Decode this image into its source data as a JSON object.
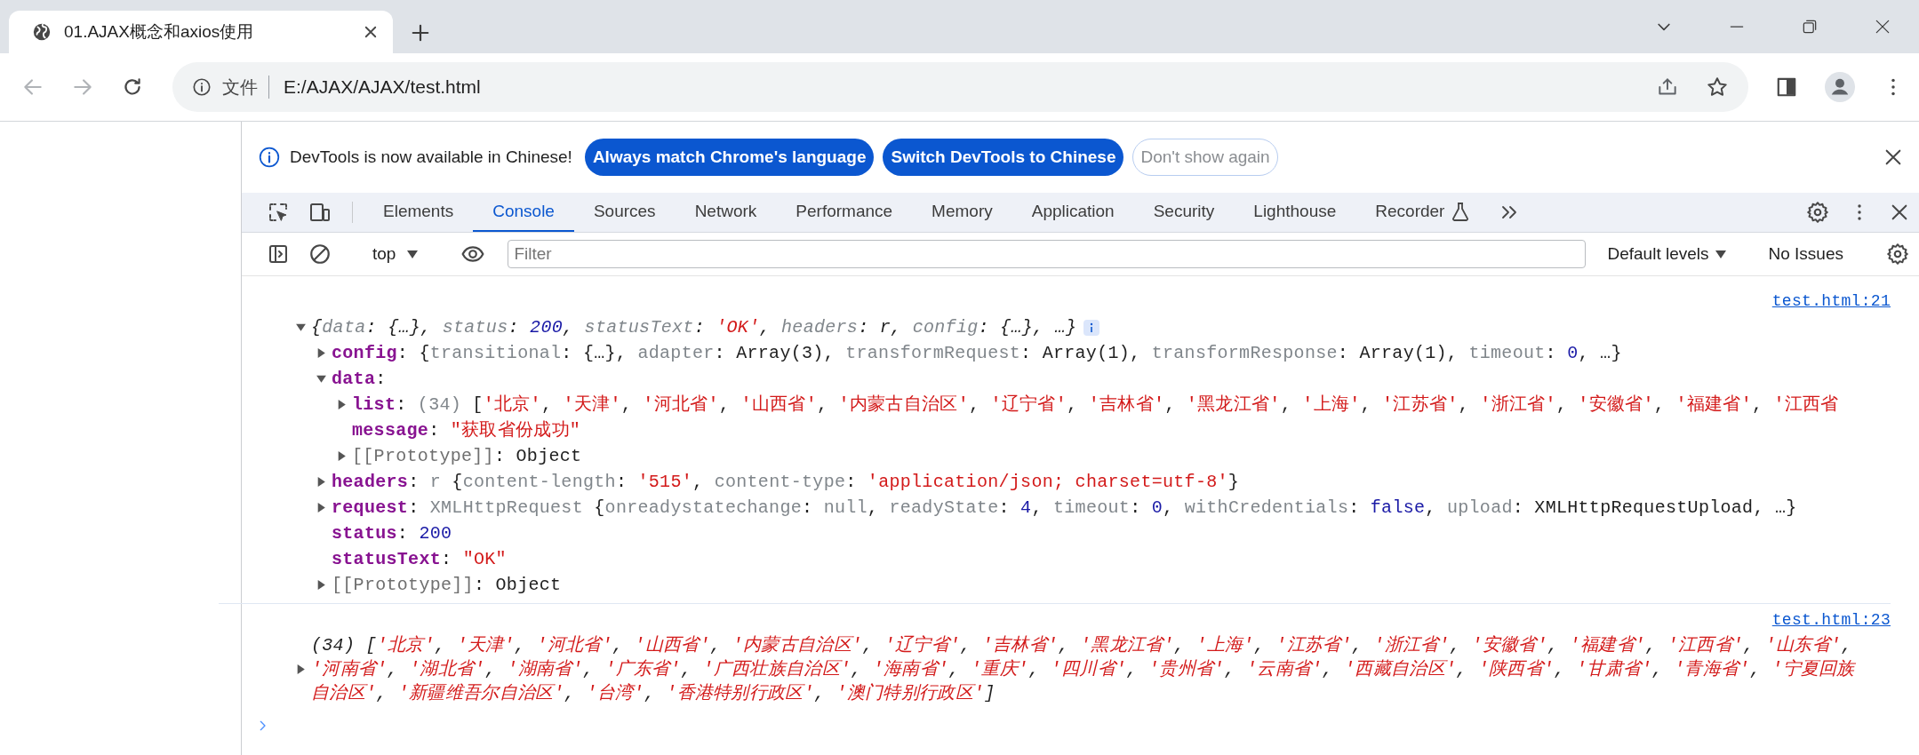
{
  "browser": {
    "tab": {
      "title": "01.AJAX概念和axios使用"
    },
    "security_label": "文件",
    "url": "E:/AJAX/AJAX/test.html"
  },
  "devtools": {
    "infobar": {
      "message": "DevTools is now available in Chinese!",
      "buttons": [
        {
          "kind": "primary",
          "label": "Always match Chrome's language"
        },
        {
          "kind": "primary",
          "label": "Switch DevTools to Chinese"
        },
        {
          "kind": "outline",
          "label": "Don't show again"
        }
      ]
    },
    "tabs": [
      {
        "label": "Elements",
        "selected": false,
        "experimental": false
      },
      {
        "label": "Console",
        "selected": true,
        "experimental": false
      },
      {
        "label": "Sources",
        "selected": false,
        "experimental": false
      },
      {
        "label": "Network",
        "selected": false,
        "experimental": false
      },
      {
        "label": "Performance",
        "selected": false,
        "experimental": false
      },
      {
        "label": "Memory",
        "selected": false,
        "experimental": false
      },
      {
        "label": "Application",
        "selected": false,
        "experimental": false
      },
      {
        "label": "Security",
        "selected": false,
        "experimental": false
      },
      {
        "label": "Lighthouse",
        "selected": false,
        "experimental": false
      },
      {
        "label": "Recorder",
        "selected": false,
        "experimental": true
      }
    ],
    "console_toolbar": {
      "context": "top",
      "filter_placeholder": "Filter",
      "levels": "Default levels",
      "issues": "No Issues"
    },
    "console": {
      "messages": [
        {
          "kind": "object",
          "source": "test.html:21",
          "expanded": true,
          "summary": [
            {
              "kind": "punct",
              "text": "{"
            },
            {
              "kind": "dimkey",
              "text": "data"
            },
            {
              "kind": "punct",
              "text": ": {…}, "
            },
            {
              "kind": "dimkey",
              "text": "status"
            },
            {
              "kind": "punct",
              "text": ": "
            },
            {
              "kind": "number",
              "text": "200"
            },
            {
              "kind": "punct",
              "text": ", "
            },
            {
              "kind": "dimkey",
              "text": "statusText"
            },
            {
              "kind": "punct",
              "text": ": "
            },
            {
              "kind": "string",
              "text": "'OK'"
            },
            {
              "kind": "punct",
              "text": ", "
            },
            {
              "kind": "dimkey",
              "text": "headers"
            },
            {
              "kind": "punct",
              "text": ": r, "
            },
            {
              "kind": "dimkey",
              "text": "config"
            },
            {
              "kind": "punct",
              "text": ": {…}, …}"
            }
          ],
          "children": [
            {
              "kind": "node",
              "expanded": false,
              "tokens": [
                {
                  "kind": "key",
                  "text": "config"
                },
                {
                  "kind": "punct",
                  "text": ": {"
                },
                {
                  "kind": "dimkey",
                  "text": "transitional"
                },
                {
                  "kind": "punct",
                  "text": ": {…}, "
                },
                {
                  "kind": "dimkey",
                  "text": "adapter"
                },
                {
                  "kind": "punct",
                  "text": ": Array(3), "
                },
                {
                  "kind": "dimkey",
                  "text": "transformRequest"
                },
                {
                  "kind": "punct",
                  "text": ": Array(1), "
                },
                {
                  "kind": "dimkey",
                  "text": "transformResponse"
                },
                {
                  "kind": "punct",
                  "text": ": Array(1), "
                },
                {
                  "kind": "dimkey",
                  "text": "timeout"
                },
                {
                  "kind": "punct",
                  "text": ": "
                },
                {
                  "kind": "number",
                  "text": "0"
                },
                {
                  "kind": "punct",
                  "text": ", …}"
                }
              ]
            },
            {
              "kind": "node",
              "expanded": true,
              "tokens": [
                {
                  "kind": "key",
                  "text": "data"
                },
                {
                  "kind": "punct",
                  "text": ":"
                }
              ],
              "children": [
                {
                  "kind": "node",
                  "expanded": false,
                  "tokens": [
                    {
                      "kind": "key",
                      "text": "list"
                    },
                    {
                      "kind": "punct",
                      "text": ": "
                    },
                    {
                      "kind": "dimkey",
                      "text": "(34)"
                    },
                    {
                      "kind": "punct",
                      "text": " ["
                    },
                    {
                      "kind": "string",
                      "text": "'北京'"
                    },
                    {
                      "kind": "punct",
                      "text": ", "
                    },
                    {
                      "kind": "string",
                      "text": "'天津'"
                    },
                    {
                      "kind": "punct",
                      "text": ", "
                    },
                    {
                      "kind": "string",
                      "text": "'河北省'"
                    },
                    {
                      "kind": "punct",
                      "text": ", "
                    },
                    {
                      "kind": "string",
                      "text": "'山西省'"
                    },
                    {
                      "kind": "punct",
                      "text": ", "
                    },
                    {
                      "kind": "string",
                      "text": "'内蒙古自治区'"
                    },
                    {
                      "kind": "punct",
                      "text": ", "
                    },
                    {
                      "kind": "string",
                      "text": "'辽宁省'"
                    },
                    {
                      "kind": "punct",
                      "text": ", "
                    },
                    {
                      "kind": "string",
                      "text": "'吉林省'"
                    },
                    {
                      "kind": "punct",
                      "text": ", "
                    },
                    {
                      "kind": "string",
                      "text": "'黑龙江省'"
                    },
                    {
                      "kind": "punct",
                      "text": ", "
                    },
                    {
                      "kind": "string",
                      "text": "'上海'"
                    },
                    {
                      "kind": "punct",
                      "text": ", "
                    },
                    {
                      "kind": "string",
                      "text": "'江苏省'"
                    },
                    {
                      "kind": "punct",
                      "text": ", "
                    },
                    {
                      "kind": "string",
                      "text": "'浙江省'"
                    },
                    {
                      "kind": "punct",
                      "text": ", "
                    },
                    {
                      "kind": "string",
                      "text": "'安徽省'"
                    },
                    {
                      "kind": "punct",
                      "text": ", "
                    },
                    {
                      "kind": "string",
                      "text": "'福建省'"
                    },
                    {
                      "kind": "punct",
                      "text": ", "
                    },
                    {
                      "kind": "string",
                      "text": "'江西省"
                    }
                  ]
                },
                {
                  "kind": "leaf",
                  "tokens": [
                    {
                      "kind": "key",
                      "text": "message"
                    },
                    {
                      "kind": "punct",
                      "text": ": "
                    },
                    {
                      "kind": "string",
                      "text": "\"获取省份成功\""
                    }
                  ]
                },
                {
                  "kind": "node",
                  "expanded": false,
                  "tokens": [
                    {
                      "kind": "internal",
                      "text": "[[Prototype]]"
                    },
                    {
                      "kind": "punct",
                      "text": ": Object"
                    }
                  ]
                }
              ]
            },
            {
              "kind": "node",
              "expanded": false,
              "tokens": [
                {
                  "kind": "key",
                  "text": "headers"
                },
                {
                  "kind": "punct",
                  "text": ": "
                },
                {
                  "kind": "dimkey",
                  "text": "r"
                },
                {
                  "kind": "punct",
                  "text": " {"
                },
                {
                  "kind": "dimkey",
                  "text": "content-length"
                },
                {
                  "kind": "punct",
                  "text": ": "
                },
                {
                  "kind": "string",
                  "text": "'515'"
                },
                {
                  "kind": "punct",
                  "text": ", "
                },
                {
                  "kind": "dimkey",
                  "text": "content-type"
                },
                {
                  "kind": "punct",
                  "text": ": "
                },
                {
                  "kind": "string",
                  "text": "'application/json; charset=utf-8'"
                },
                {
                  "kind": "punct",
                  "text": "}"
                }
              ]
            },
            {
              "kind": "node",
              "expanded": false,
              "tokens": [
                {
                  "kind": "key",
                  "text": "request"
                },
                {
                  "kind": "punct",
                  "text": ": "
                },
                {
                  "kind": "dimkey",
                  "text": "XMLHttpRequest"
                },
                {
                  "kind": "punct",
                  "text": " {"
                },
                {
                  "kind": "dimkey",
                  "text": "onreadystatechange"
                },
                {
                  "kind": "punct",
                  "text": ": "
                },
                {
                  "kind": "dimkey",
                  "text": "null"
                },
                {
                  "kind": "punct",
                  "text": ", "
                },
                {
                  "kind": "dimkey",
                  "text": "readyState"
                },
                {
                  "kind": "punct",
                  "text": ": "
                },
                {
                  "kind": "number",
                  "text": "4"
                },
                {
                  "kind": "punct",
                  "text": ", "
                },
                {
                  "kind": "dimkey",
                  "text": "timeout"
                },
                {
                  "kind": "punct",
                  "text": ": "
                },
                {
                  "kind": "number",
                  "text": "0"
                },
                {
                  "kind": "punct",
                  "text": ", "
                },
                {
                  "kind": "dimkey",
                  "text": "withCredentials"
                },
                {
                  "kind": "punct",
                  "text": ": "
                },
                {
                  "kind": "number",
                  "text": "false"
                },
                {
                  "kind": "punct",
                  "text": ", "
                },
                {
                  "kind": "dimkey",
                  "text": "upload"
                },
                {
                  "kind": "punct",
                  "text": ": XMLHttpRequestUpload, …}"
                }
              ]
            },
            {
              "kind": "leaf",
              "tokens": [
                {
                  "kind": "key",
                  "text": "status"
                },
                {
                  "kind": "punct",
                  "text": ": "
                },
                {
                  "kind": "number",
                  "text": "200"
                }
              ]
            },
            {
              "kind": "leaf",
              "tokens": [
                {
                  "kind": "key",
                  "text": "statusText"
                },
                {
                  "kind": "punct",
                  "text": ": "
                },
                {
                  "kind": "string",
                  "text": "\"OK\""
                }
              ]
            },
            {
              "kind": "node",
              "expanded": false,
              "tokens": [
                {
                  "kind": "internal",
                  "text": "[[Prototype]]"
                },
                {
                  "kind": "punct",
                  "text": ": Object"
                }
              ]
            }
          ]
        },
        {
          "kind": "array",
          "source": "test.html:23",
          "expanded": false,
          "summary": [
            {
              "kind": "punct",
              "text": "(34) ["
            },
            {
              "kind": "string",
              "text": "'北京'"
            },
            {
              "kind": "punct",
              "text": ", "
            },
            {
              "kind": "string",
              "text": "'天津'"
            },
            {
              "kind": "punct",
              "text": ", "
            },
            {
              "kind": "string",
              "text": "'河北省'"
            },
            {
              "kind": "punct",
              "text": ", "
            },
            {
              "kind": "string",
              "text": "'山西省'"
            },
            {
              "kind": "punct",
              "text": ", "
            },
            {
              "kind": "string",
              "text": "'内蒙古自治区'"
            },
            {
              "kind": "punct",
              "text": ", "
            },
            {
              "kind": "string",
              "text": "'辽宁省'"
            },
            {
              "kind": "punct",
              "text": ", "
            },
            {
              "kind": "string",
              "text": "'吉林省'"
            },
            {
              "kind": "punct",
              "text": ", "
            },
            {
              "kind": "string",
              "text": "'黑龙江省'"
            },
            {
              "kind": "punct",
              "text": ", "
            },
            {
              "kind": "string",
              "text": "'上海'"
            },
            {
              "kind": "punct",
              "text": ", "
            },
            {
              "kind": "string",
              "text": "'江苏省'"
            },
            {
              "kind": "punct",
              "text": ", "
            },
            {
              "kind": "string",
              "text": "'浙江省'"
            },
            {
              "kind": "punct",
              "text": ", "
            },
            {
              "kind": "string",
              "text": "'安徽省'"
            },
            {
              "kind": "punct",
              "text": ", "
            },
            {
              "kind": "string",
              "text": "'福建省'"
            },
            {
              "kind": "punct",
              "text": ", "
            },
            {
              "kind": "string",
              "text": "'江西省'"
            },
            {
              "kind": "punct",
              "text": ", "
            },
            {
              "kind": "string",
              "text": "'山东省'"
            },
            {
              "kind": "punct",
              "text": ", "
            },
            {
              "kind": "string",
              "text": "'河南省'"
            },
            {
              "kind": "punct",
              "text": ", "
            },
            {
              "kind": "string",
              "text": "'湖北省'"
            },
            {
              "kind": "punct",
              "text": ", "
            },
            {
              "kind": "string",
              "text": "'湖南省'"
            },
            {
              "kind": "punct",
              "text": ", "
            },
            {
              "kind": "string",
              "text": "'广东省'"
            },
            {
              "kind": "punct",
              "text": ", "
            },
            {
              "kind": "string",
              "text": "'广西壮族自治区'"
            },
            {
              "kind": "punct",
              "text": ", "
            },
            {
              "kind": "string",
              "text": "'海南省'"
            },
            {
              "kind": "punct",
              "text": ", "
            },
            {
              "kind": "string",
              "text": "'重庆'"
            },
            {
              "kind": "punct",
              "text": ", "
            },
            {
              "kind": "string",
              "text": "'四川省'"
            },
            {
              "kind": "punct",
              "text": ", "
            },
            {
              "kind": "string",
              "text": "'贵州省'"
            },
            {
              "kind": "punct",
              "text": ", "
            },
            {
              "kind": "string",
              "text": "'云南省'"
            },
            {
              "kind": "punct",
              "text": ", "
            },
            {
              "kind": "string",
              "text": "'西藏自治区'"
            },
            {
              "kind": "punct",
              "text": ", "
            },
            {
              "kind": "string",
              "text": "'陕西省'"
            },
            {
              "kind": "punct",
              "text": ", "
            },
            {
              "kind": "string",
              "text": "'甘肃省'"
            },
            {
              "kind": "punct",
              "text": ", "
            },
            {
              "kind": "string",
              "text": "'青海省'"
            },
            {
              "kind": "punct",
              "text": ", "
            },
            {
              "kind": "string",
              "text": "'宁夏回族自治区'"
            },
            {
              "kind": "punct",
              "text": ", "
            },
            {
              "kind": "string",
              "text": "'新疆维吾尔自治区'"
            },
            {
              "kind": "punct",
              "text": ", "
            },
            {
              "kind": "string",
              "text": "'台湾'"
            },
            {
              "kind": "punct",
              "text": ", "
            },
            {
              "kind": "string",
              "text": "'香港特别行政区'"
            },
            {
              "kind": "punct",
              "text": ", "
            },
            {
              "kind": "string",
              "text": "'澳门特别行政区'"
            },
            {
              "kind": "punct",
              "text": "]"
            }
          ]
        }
      ]
    }
  }
}
